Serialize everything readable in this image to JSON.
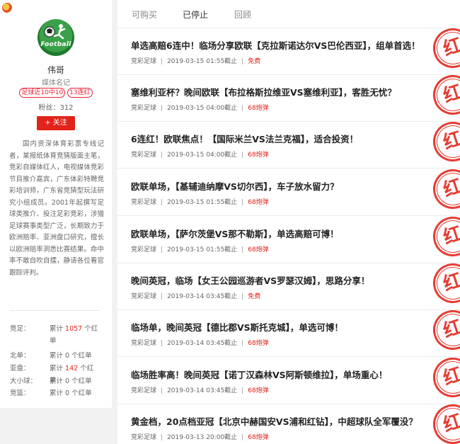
{
  "profile": {
    "avatar_text": "Football",
    "name": "伟哥",
    "role": "媒体名记",
    "badges": [
      "足球近10中10",
      "13连红"
    ],
    "fans_label": "粉丝：",
    "fans_count": "312",
    "follow_label": "+ 关注",
    "bio": "国内资深体育彩票专线记者，某报纸体育竞猜版面主笔，竞彩自媒体红人，电视媒体竞彩节目推介嘉宾，广东体彩特聘竞彩培训师，广东省竞猜型玩法研究小组成员。2001年起撰写足球类推介、投注足彩竞彩，涉猎足球赛事类型广泛，长期致力于欧洲赔率、亚洲盘口研究，擅长以欧洲赔率洞悉比赛结果。命中率不敢自吹自擂，静请各位看官跟踪评判。"
  },
  "stats": [
    {
      "key": "竞足：",
      "prefix": "累计",
      "num": "1057",
      "suffix": "个红单"
    },
    {
      "key": "北单：",
      "prefix": "累计",
      "num": "0",
      "suffix": "个红单"
    },
    {
      "key": "亚盘：",
      "prefix": "累计",
      "num": "142",
      "suffix": "个红单"
    },
    {
      "key": "大小球：",
      "prefix": "累计",
      "num": "0",
      "suffix": "个红单"
    },
    {
      "key": "竞篮：",
      "prefix": "累计",
      "num": "0",
      "suffix": "个红单"
    }
  ],
  "tabs": [
    "可购买",
    "已停止",
    "回顾"
  ],
  "stamp_text": "红",
  "items": [
    {
      "title": "单选高赔6连中！临场分享欧联【克拉斯诺达尔VS巴伦西亚】，组单首选！",
      "category": "竞彩足球",
      "time": "2019-03-15 01:55截止",
      "price": "免费"
    },
    {
      "title": "塞维利亚杯？晚间欧联【布拉格斯拉维亚VS塞维利亚】，客胜无忧？",
      "category": "竞彩足球",
      "time": "2019-03-15 04:00截止",
      "price": "68炮弹"
    },
    {
      "title": "6连红！欧联焦点！【国际米兰VS法兰克福】，适合投资！",
      "category": "竞彩足球",
      "time": "2019-03-15 04:00截止",
      "price": "68炮弹"
    },
    {
      "title": "欧联单场，【基辅迪纳摩VS切尔西】，车子放水留力？",
      "category": "竞彩足球",
      "time": "2019-03-15 01:55截止",
      "price": "68炮弹"
    },
    {
      "title": "欧联单场，【萨尔茨堡VS那不勒斯】，单选高赔可博！",
      "category": "竞彩足球",
      "time": "2019-03-15 01:55截止",
      "price": "68炮弹"
    },
    {
      "title": "晚间英冠，临场【女王公园巡游者VS罗瑟汉姆】，思路分享！",
      "category": "竞彩足球",
      "time": "2019-03-14 03:45截止",
      "price": "免费"
    },
    {
      "title": "临场单，晚间英冠【德比郡VS斯托克城】，单选可博！",
      "category": "竞彩足球",
      "time": "2019-03-14 03:45截止",
      "price": "68炮弹"
    },
    {
      "title": "临场胜率高！晚间英冠【诺丁汉森林VS阿斯顿维拉】，单场重心！",
      "category": "竞彩足球",
      "time": "2019-03-14 03:45截止",
      "price": "68炮弹"
    },
    {
      "title": "黄金档，20点档亚冠【北京中赫国安VS浦和红钻】，中超球队全军覆没？",
      "category": "竞彩足球",
      "time": "2019-03-13 20:00截止",
      "price": "68炮弹"
    }
  ]
}
